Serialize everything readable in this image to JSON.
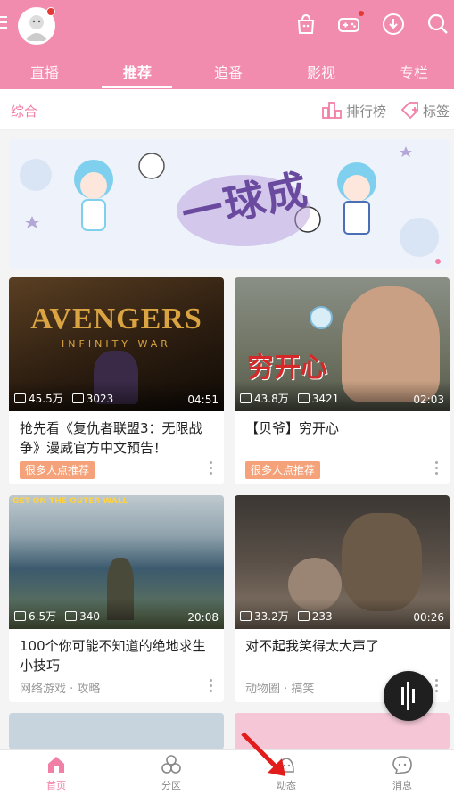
{
  "header": {
    "tabs": [
      {
        "label": "直播"
      },
      {
        "label": "推荐"
      },
      {
        "label": "追番"
      },
      {
        "label": "影视"
      },
      {
        "label": "专栏"
      }
    ],
    "active_tab": "推荐"
  },
  "subbar": {
    "title": "综合",
    "ranking_label": "排行榜",
    "tag_label": "标签"
  },
  "banner": {
    "title_text": "一球成名"
  },
  "cards": [
    {
      "views": "45.5万",
      "danmaku": "3023",
      "duration": "04:51",
      "title": "抢先看《复仇者联盟3：无限战争》漫威官方中文预告！",
      "badge": "很多人点推荐",
      "thumb_text": "AVENGERS",
      "thumb_sub": "INFINITY WAR"
    },
    {
      "views": "43.8万",
      "danmaku": "3421",
      "duration": "02:03",
      "title": "【贝爷】穷开心",
      "badge": "很多人点推荐",
      "thumb_text": "穷开心"
    },
    {
      "views": "6.5万",
      "danmaku": "340",
      "duration": "20:08",
      "title": "100个你可能不知道的绝地求生小技巧",
      "meta": "网络游戏 · 攻略",
      "thumb_text": "GET ON THE OUTER WALL"
    },
    {
      "views": "33.2万",
      "danmaku": "233",
      "duration": "00:26",
      "title": "对不起我笑得太大声了",
      "meta": "动物圈 · 搞笑"
    }
  ],
  "bottom_nav": [
    {
      "label": "首页",
      "icon": "home-icon"
    },
    {
      "label": "分区",
      "icon": "category-icon"
    },
    {
      "label": "动态",
      "icon": "dynamic-icon"
    },
    {
      "label": "消息",
      "icon": "message-icon"
    }
  ],
  "colors": {
    "brand_pink": "#f28cae",
    "accent_pink": "#f27fa5",
    "badge_orange": "#f5a27a"
  }
}
